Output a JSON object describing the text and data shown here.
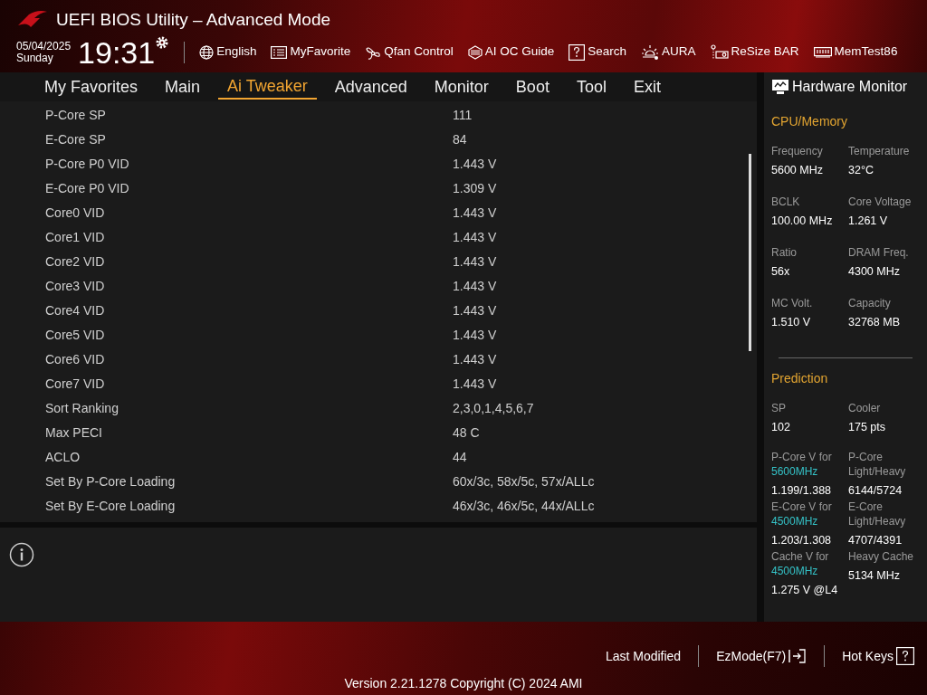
{
  "header": {
    "title": "UEFI BIOS Utility – Advanced Mode",
    "date": "05/04/2025",
    "weekday": "Sunday",
    "time": "19:31",
    "toolbar": [
      {
        "kind": "globe",
        "label": "English"
      },
      {
        "kind": "list",
        "label": "MyFavorite"
      },
      {
        "kind": "fan",
        "label": "Qfan Control"
      },
      {
        "kind": "chip",
        "label": "AI OC Guide"
      },
      {
        "kind": "question",
        "label": "Search"
      },
      {
        "kind": "aura",
        "label": "AURA"
      },
      {
        "kind": "card",
        "label": "ReSize BAR"
      },
      {
        "kind": "memory",
        "label": "MemTest86"
      }
    ]
  },
  "tabs": [
    {
      "label": "My Favorites",
      "selected": false
    },
    {
      "label": "Main",
      "selected": false
    },
    {
      "label": "Ai Tweaker",
      "selected": true
    },
    {
      "label": "Advanced",
      "selected": false
    },
    {
      "label": "Monitor",
      "selected": false
    },
    {
      "label": "Boot",
      "selected": false
    },
    {
      "label": "Tool",
      "selected": false
    },
    {
      "label": "Exit",
      "selected": false
    }
  ],
  "settings": [
    {
      "label": "P-Core SP",
      "value": "111"
    },
    {
      "label": "E-Core SP",
      "value": "84"
    },
    {
      "label": "P-Core P0 VID",
      "value": "1.443 V"
    },
    {
      "label": "E-Core P0 VID",
      "value": "1.309 V"
    },
    {
      "label": "Core0 VID",
      "value": "1.443 V"
    },
    {
      "label": "Core1 VID",
      "value": "1.443 V"
    },
    {
      "label": "Core2 VID",
      "value": "1.443 V"
    },
    {
      "label": "Core3 VID",
      "value": "1.443 V"
    },
    {
      "label": "Core4 VID",
      "value": "1.443 V"
    },
    {
      "label": "Core5 VID",
      "value": "1.443 V"
    },
    {
      "label": "Core6 VID",
      "value": "1.443 V"
    },
    {
      "label": "Core7 VID",
      "value": "1.443 V"
    },
    {
      "label": "Sort Ranking",
      "value": "2,3,0,1,4,5,6,7"
    },
    {
      "label": "Max PECI",
      "value": "48 C"
    },
    {
      "label": "ACLO",
      "value": "44"
    },
    {
      "label": "Set By P-Core Loading",
      "value": "60x/3c, 58x/5c, 57x/ALLc"
    },
    {
      "label": "Set By E-Core Loading",
      "value": "46x/3c, 46x/5c, 44x/ALLc"
    }
  ],
  "hardware_monitor": {
    "title": "Hardware Monitor",
    "sections": [
      {
        "title": "CPU/Memory",
        "items": [
          {
            "label": "Frequency",
            "value": "5600 MHz"
          },
          {
            "label": "Temperature",
            "value": "32°C"
          },
          {
            "label": "BCLK",
            "value": "100.00 MHz"
          },
          {
            "label": "Core Voltage",
            "value": "1.261 V"
          },
          {
            "label": "Ratio",
            "value": "56x"
          },
          {
            "label": "DRAM Freq.",
            "value": "4300 MHz"
          },
          {
            "label": "MC Volt.",
            "value": "1.510 V"
          },
          {
            "label": "Capacity",
            "value": "32768 MB"
          }
        ]
      },
      {
        "title": "Prediction",
        "items": [
          {
            "label": "SP",
            "value": "102"
          },
          {
            "label": "Cooler",
            "value": "175 pts"
          },
          {
            "label": "P-Core V for",
            "frequency": "5600MHz",
            "value": "1.199/1.388"
          },
          {
            "label": "P-Core Light/Heavy",
            "value": "6144/5724"
          },
          {
            "label": "E-Core V for",
            "frequency": "4500MHz",
            "value": "1.203/1.308"
          },
          {
            "label": "E-Core Light/Heavy",
            "value": "4707/4391"
          },
          {
            "label": "Cache V for",
            "frequency": "4500MHz",
            "value": "1.275 V @L4"
          },
          {
            "label": "Heavy Cache",
            "value": "5134 MHz"
          }
        ]
      }
    ]
  },
  "footer": {
    "actions": [
      {
        "kind": "plain",
        "label": "Last Modified"
      },
      {
        "kind": "exit",
        "label": "EzMode(F7)"
      },
      {
        "kind": "help",
        "label": "Hot Keys"
      }
    ],
    "version": "Version 2.21.1278 Copyright (C) 2024 AMI"
  }
}
